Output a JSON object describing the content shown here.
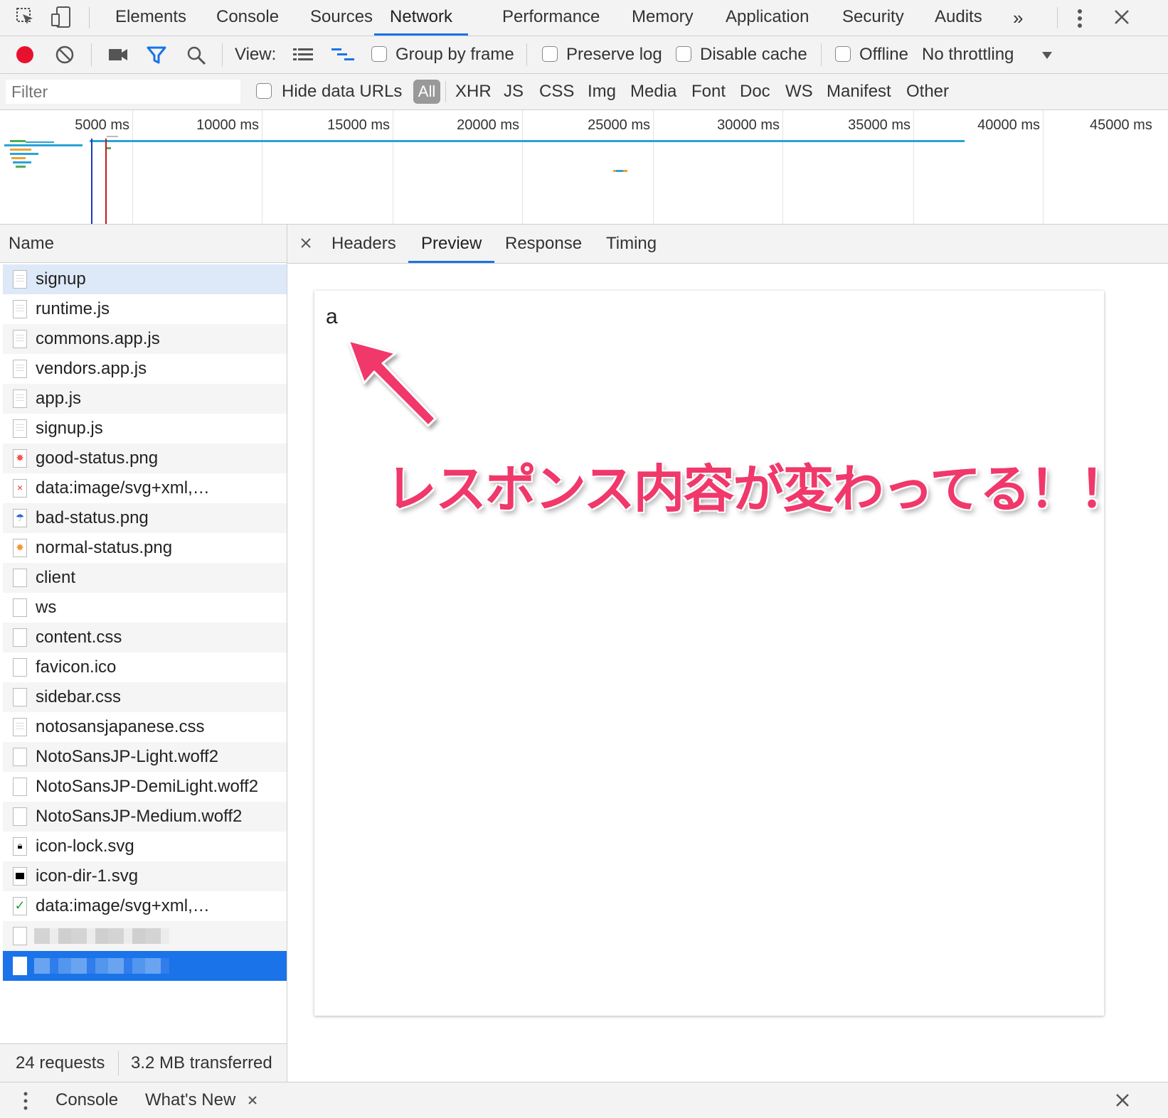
{
  "top_tabs": [
    "Elements",
    "Console",
    "Sources",
    "Network",
    "Performance",
    "Memory",
    "Application",
    "Security",
    "Audits"
  ],
  "toolbar": {
    "view_label": "View:",
    "group_by_frame": "Group by frame",
    "preserve_log": "Preserve log",
    "disable_cache": "Disable cache",
    "offline": "Offline",
    "throttling": "No throttling"
  },
  "filter": {
    "placeholder": "Filter",
    "hide_data_urls": "Hide data URLs",
    "all": "All",
    "types": [
      "XHR",
      "JS",
      "CSS",
      "Img",
      "Media",
      "Font",
      "Doc",
      "WS",
      "Manifest",
      "Other"
    ]
  },
  "overview": {
    "ticks": [
      "5000 ms",
      "10000 ms",
      "15000 ms",
      "20000 ms",
      "25000 ms",
      "30000 ms",
      "35000 ms",
      "40000 ms",
      "45000 ms"
    ]
  },
  "requests": {
    "header": "Name",
    "items": [
      "signup",
      "runtime.js",
      "commons.app.js",
      "vendors.app.js",
      "app.js",
      "signup.js",
      "good-status.png",
      "data:image/svg+xml,…",
      "bad-status.png",
      "normal-status.png",
      "client",
      "ws",
      "content.css",
      "favicon.ico",
      "sidebar.css",
      "notosansjapanese.css",
      "NotoSansJP-Light.woff2",
      "NotoSansJP-DemiLight.woff2",
      "NotoSansJP-Medium.woff2",
      "icon-lock.svg",
      "icon-dir-1.svg",
      "data:image/svg+xml,…"
    ],
    "summary_requests": "24 requests",
    "summary_transferred": "3.2 MB transferred"
  },
  "detail": {
    "tabs": [
      "Headers",
      "Preview",
      "Response",
      "Timing"
    ],
    "preview_text": "a",
    "annotation": "レスポンス内容が変わってる！！"
  },
  "drawer": {
    "console": "Console",
    "whats_new": "What's New"
  },
  "colors": {
    "accent": "#1a73e8",
    "record": "#e8112d",
    "annotation": "#f0386b"
  }
}
